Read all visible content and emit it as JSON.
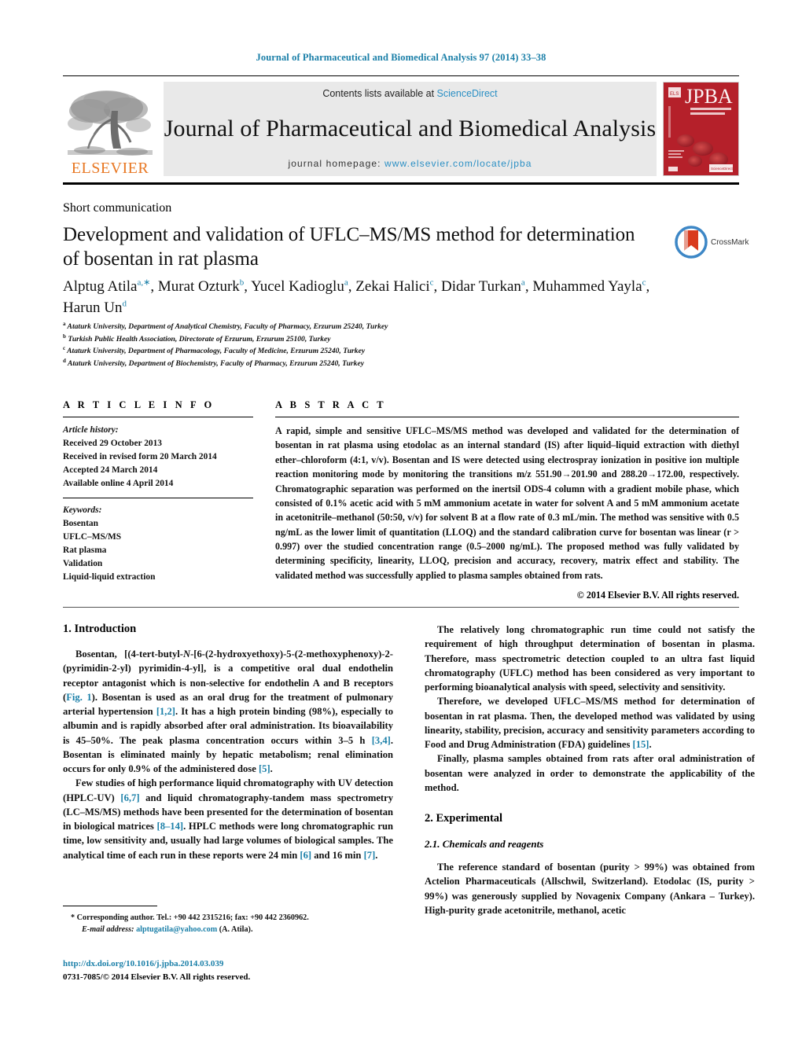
{
  "running_head": "Journal of Pharmaceutical and Biomedical Analysis 97 (2014) 33–38",
  "masthead": {
    "contents_prefix": "Contents lists available at ",
    "sciencedirect": "ScienceDirect",
    "journal_title": "Journal of Pharmaceutical and Biomedical Analysis",
    "homepage_prefix": "journal homepage: ",
    "homepage_url": "www.elsevier.com/locate/jpba",
    "publisher_wordmark": "ELSEVIER",
    "cover_acronym": "JPBA",
    "cover_subtitle": "Journal of Pharmaceutical and Biomedical Analysis"
  },
  "article": {
    "type": "Short communication",
    "title": "Development and validation of UFLC–MS/MS method for determination of bosentan in rat plasma",
    "crossmark_label": "CrossMark",
    "authors_line1": "Alptug Atila",
    "authors_html": "Alptug Atila<sup>a,∗</sup>, Murat Ozturk<sup>b</sup>, Yucel Kadioglu<sup>a</sup>, Zekai Halici<sup>c</sup>, Didar Turkan<sup>a</sup>, Muhammed Yayla<sup>c</sup>, Harun Un<sup>d</sup>",
    "affiliations": [
      {
        "marker": "a",
        "text": "Ataturk University, Department of Analytical Chemistry, Faculty of Pharmacy, Erzurum 25240, Turkey"
      },
      {
        "marker": "b",
        "text": "Turkish Public Health Association, Directorate of Erzurum, Erzurum 25100, Turkey"
      },
      {
        "marker": "c",
        "text": "Ataturk University, Department of Pharmacology, Faculty of Medicine, Erzurum 25240, Turkey"
      },
      {
        "marker": "d",
        "text": "Ataturk University, Department of Biochemistry, Faculty of Pharmacy, Erzurum 25240, Turkey"
      }
    ]
  },
  "article_info": {
    "heading": "A R T I C L E    I N F O",
    "history_label": "Article history:",
    "history": [
      "Received 29 October 2013",
      "Received in revised form 20 March 2014",
      "Accepted 24 March 2014",
      "Available online 4 April 2014"
    ],
    "keywords_label": "Keywords:",
    "keywords": [
      "Bosentan",
      "UFLC–MS/MS",
      "Rat plasma",
      "Validation",
      "Liquid-liquid extraction"
    ]
  },
  "abstract": {
    "heading": "A B S T R A C T",
    "text": "A rapid, simple and sensitive UFLC–MS/MS method was developed and validated for the determination of bosentan in rat plasma using etodolac as an internal standard (IS) after liquid–liquid extraction with diethyl ether–chloroform (4:1, v/v). Bosentan and IS were detected using electrospray ionization in positive ion multiple reaction monitoring mode by monitoring the transitions m/z 551.90→201.90 and 288.20→172.00, respectively. Chromatographic separation was performed on the inertsil ODS-4 column with a gradient mobile phase, which consisted of 0.1% acetic acid with 5 mM ammonium acetate in water for solvent A and 5 mM ammonium acetate in acetonitrile–methanol (50:50, v/v) for solvent B at a flow rate of 0.3 mL/min. The method was sensitive with 0.5 ng/mL as the lower limit of quantitation (LLOQ) and the standard calibration curve for bosentan was linear (r > 0.997) over the studied concentration range (0.5–2000 ng/mL). The proposed method was fully validated by determining specificity, linearity, LLOQ, precision and accuracy, recovery, matrix effect and stability. The validated method was successfully applied to plasma samples obtained from rats.",
    "copyright": "© 2014 Elsevier B.V. All rights reserved."
  },
  "body": {
    "left_column": {
      "section_1_heading": "1.  Introduction",
      "paragraph_1_html": "Bosentan, [(4-tert-butyl-<i>N</i>-[6-(2-hydroxyethoxy)-5-(2-methoxyphenoxy)-2-(pyrimidin-2-yl) pyrimidin-4-yl], is a competitive oral dual endothelin receptor antagonist which is non-selective for endothelin A and B receptors (<span class=\"lnk\">Fig. 1</span>). Bosentan is used as an oral drug for the treatment of pulmonary arterial hypertension <span class=\"ref\">[1,2]</span>. It has a high protein binding (98%), especially to albumin and is rapidly absorbed after oral administration. Its bioavailability is 45–50%. The peak plasma concentration occurs within 3–5 h <span class=\"ref\">[3,4]</span>. Bosentan is eliminated mainly by hepatic metabolism; renal elimination occurs for only 0.9% of the administered dose <span class=\"ref\">[5]</span>.",
      "paragraph_2_html": "Few studies of high performance liquid chromatography with UV detection (HPLC-UV) <span class=\"ref\">[6,7]</span> and liquid chromatography-tandem mass spectrometry (LC–MS/MS) methods have been presented for the determination of bosentan in biological matrices <span class=\"ref\">[8–14]</span>. HPLC methods were long chromatographic run time, low sensitivity and, usually had large volumes of biological samples. The analytical time of each run in these reports were 24 min <span class=\"ref\">[6]</span> and 16 min <span class=\"ref\">[7]</span>."
    },
    "right_column": {
      "paragraph_1_html": "The relatively long chromatographic run time could not satisfy the requirement of high throughput determination of bosentan in plasma. Therefore, mass spectrometric detection coupled to an ultra fast liquid chromatography (UFLC) method has been considered as very important to performing bioanalytical analysis with speed, selectivity and sensitivity.",
      "paragraph_2_html": "Therefore, we developed UFLC–MS/MS method for determination of bosentan in rat plasma. Then, the developed method was validated by using linearity, stability, precision, accuracy and sensitivity parameters according to Food and Drug Administration (FDA) guidelines <span class=\"ref\">[15]</span>.",
      "paragraph_3_html": "Finally, plasma samples obtained from rats after oral administration of bosentan were analyzed in order to demonstrate the applicability of the method.",
      "section_2_heading": "2.  Experimental",
      "subsection_2_1_heading": "2.1.  Chemicals and reagents",
      "paragraph_4_html": "The reference standard of bosentan (purity > 99%) was obtained from Actelion Pharmaceuticals (Allschwil, Switzerland). Etodolac (IS, purity > 99%) was generously supplied by Novagenix Company (Ankara – Turkey). High-purity grade acetonitrile, methanol, acetic"
    }
  },
  "footnote": {
    "corresponding_html": "<span style=\"font-weight:bold\">*</span>  Corresponding author. Tel.: +90 442 2315216; fax: +90 442 2360962.",
    "email_html": "<span class=\"em\">E-mail address:</span> <span class=\"doi-link\">alptugatila@yahoo.com</span> (A. Atila).",
    "doi": "http://dx.doi.org/10.1016/j.jpba.2014.03.039",
    "issn_line": "0731-7085/© 2014 Elsevier B.V. All rights reserved."
  },
  "colors": {
    "link_blue": "#1a7fa8",
    "sciencedirect_blue": "#2a8fc4",
    "elsevier_orange": "#E87722",
    "cover_red": "#b5202a",
    "banner_gray": "#e9e9e9"
  }
}
